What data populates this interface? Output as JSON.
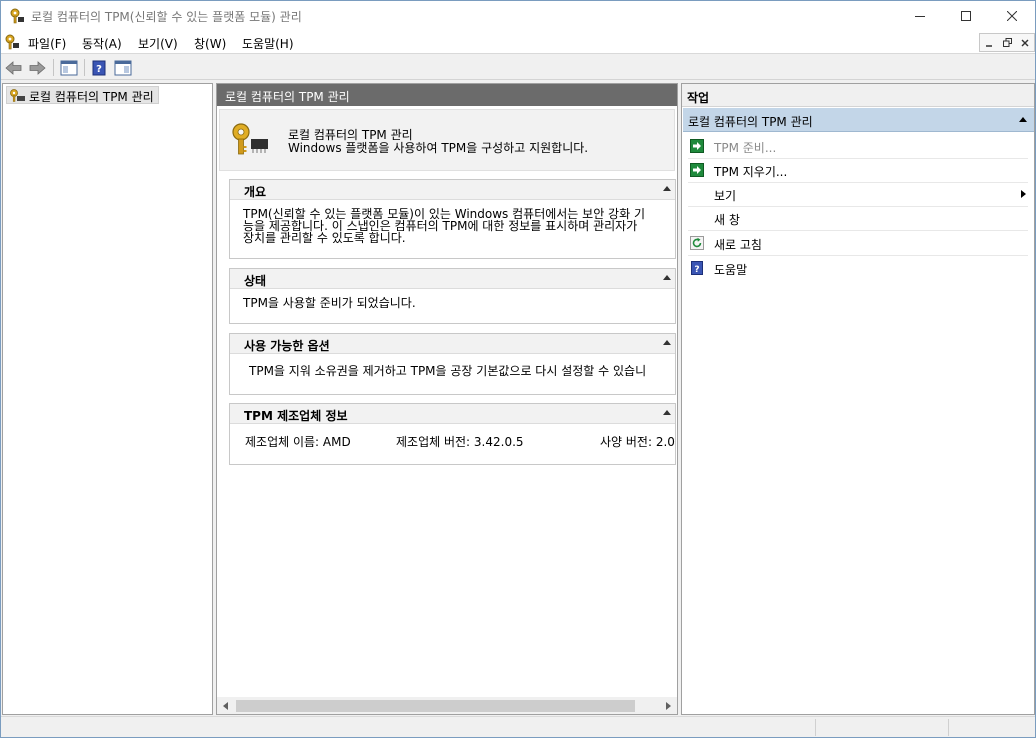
{
  "window": {
    "title": "로컬 컴퓨터의 TPM(신뢰할 수 있는 플랫폼 모듈) 관리"
  },
  "menu": {
    "items": [
      "파일(F)",
      "동작(A)",
      "보기(V)",
      "창(W)",
      "도움말(H)"
    ]
  },
  "tree": {
    "root_label": "로컬 컴퓨터의 TPM 관리"
  },
  "center": {
    "header": "로컬 컴퓨터의 TPM 관리",
    "banner_title": "로컬 컴퓨터의 TPM 관리",
    "banner_subtitle": "Windows 플랫폼을 사용하여 TPM을 구성하고 지원합니다.",
    "sections": {
      "overview": {
        "title": "개요",
        "lines": [
          "TPM(신뢰할 수 있는 플랫폼 모듈)이 있는 Windows 컴퓨터에서는 보안 강화 기",
          "능을 제공합니다. 이 스냅인은 컴퓨터의 TPM에 대한 정보를 표시하며 관리자가",
          "장치를 관리할 수 있도록 합니다."
        ]
      },
      "status": {
        "title": "상태",
        "text": "TPM을 사용할 준비가 되었습니다."
      },
      "options": {
        "title": "사용 가능한 옵션",
        "text": "TPM을 지워 소유권을 제거하고 TPM을 공장 기본값으로 다시 설정할 수 있습니"
      },
      "manufacturer": {
        "title": "TPM 제조업체 정보",
        "name": "제조업체 이름: AMD",
        "version": "제조업체 버전: 3.42.0.5",
        "spec": "사양 버전: 2.0"
      }
    }
  },
  "actions": {
    "header": "작업",
    "group_title": "로컬 컴퓨터의 TPM 관리",
    "items": {
      "prepare": "TPM 준비...",
      "clear": "TPM 지우기...",
      "view": "보기",
      "new_window": "새 창",
      "refresh": "새로 고침",
      "help": "도움말"
    }
  },
  "colors": {
    "center_header_bg": "#6b6b6b",
    "action_group_bg": "#c3d6e8",
    "green_action": "#1f8a3c",
    "help_blue": "#3a55b4"
  }
}
